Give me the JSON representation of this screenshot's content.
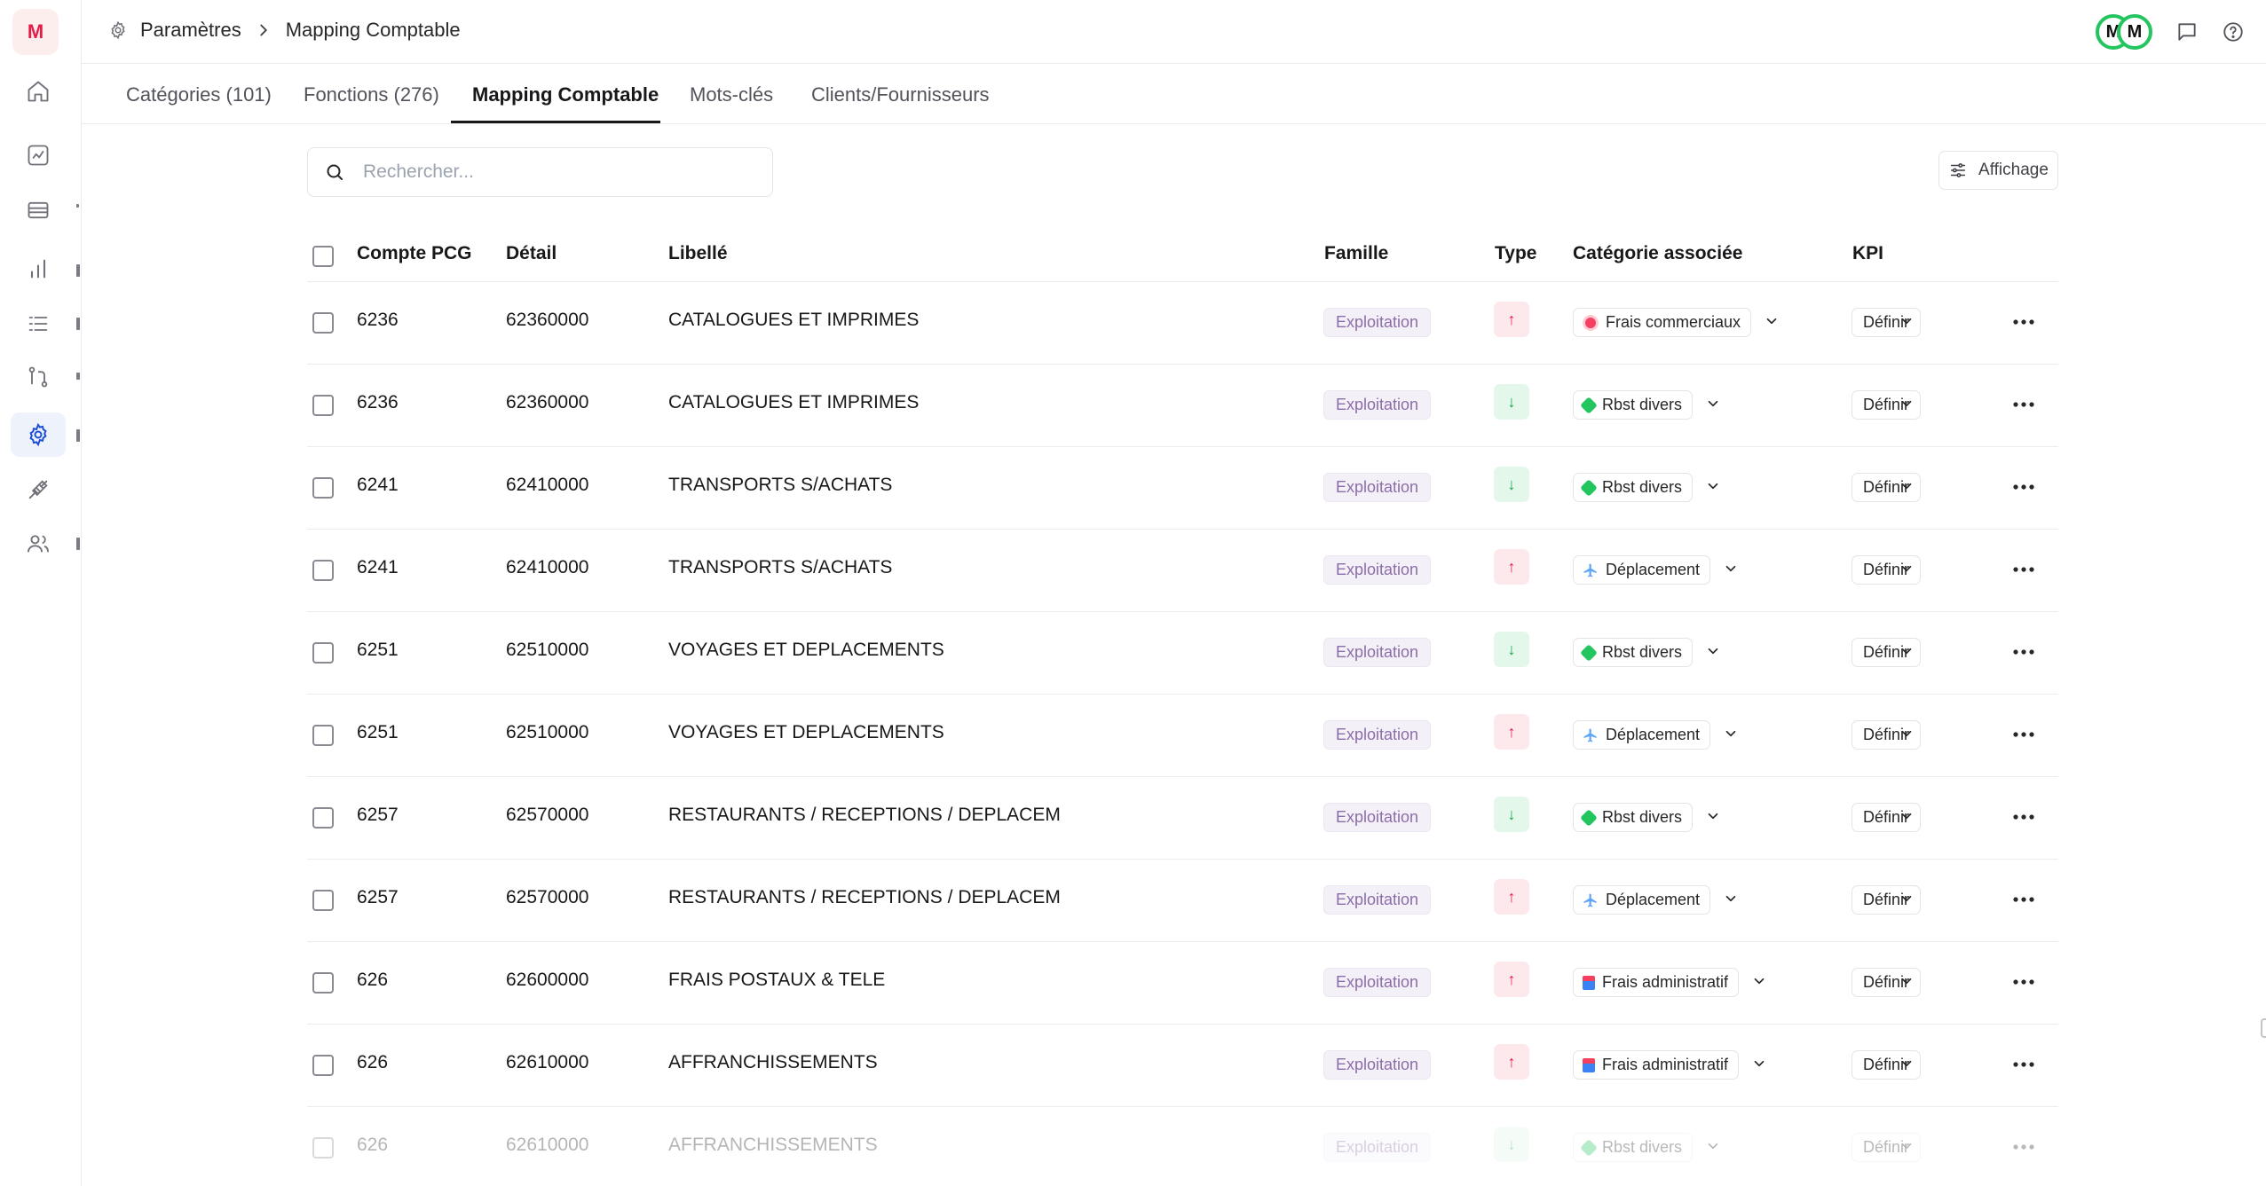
{
  "app": {
    "logo_letter": "M"
  },
  "breadcrumb": {
    "root": "Paramètres",
    "current": "Mapping Comptable"
  },
  "header": {
    "avatars": [
      "M",
      "M"
    ]
  },
  "tabs": [
    {
      "label": "Catégories (101)"
    },
    {
      "label": "Fonctions (276)"
    },
    {
      "label": "Mapping Comptable",
      "active": true
    },
    {
      "label": "Mots-clés"
    },
    {
      "label": "Clients/Fournisseurs"
    }
  ],
  "search": {
    "placeholder": "Rechercher...",
    "value": ""
  },
  "view_button": {
    "label": "Affichage"
  },
  "table": {
    "headers": {
      "compte": "Compte PCG",
      "detail": "Détail",
      "libelle": "Libellé",
      "famille": "Famille",
      "type": "Type",
      "categorie": "Catégorie associée",
      "kpi": "KPI"
    },
    "rows": [
      {
        "compte": "6236",
        "detail": "62360000",
        "libelle": "CATALOGUES ET IMPRIMES",
        "famille": "Exploitation",
        "type": "up",
        "type_glyph": "↑",
        "categorie": "Frais commerciaux",
        "cat_icon": "target-icon",
        "kpi": "Définir"
      },
      {
        "compte": "6236",
        "detail": "62360000",
        "libelle": "CATALOGUES ET IMPRIMES",
        "famille": "Exploitation",
        "type": "down",
        "type_glyph": "↓",
        "categorie": "Rbst divers",
        "cat_icon": "money-icon",
        "kpi": "Définir"
      },
      {
        "compte": "6241",
        "detail": "62410000",
        "libelle": "TRANSPORTS S/ACHATS",
        "famille": "Exploitation",
        "type": "down",
        "type_glyph": "↓",
        "categorie": "Rbst divers",
        "cat_icon": "money-icon",
        "kpi": "Définir"
      },
      {
        "compte": "6241",
        "detail": "62410000",
        "libelle": "TRANSPORTS S/ACHATS",
        "famille": "Exploitation",
        "type": "up",
        "type_glyph": "↑",
        "categorie": "Déplacement",
        "cat_icon": "plane-icon",
        "kpi": "Définir"
      },
      {
        "compte": "6251",
        "detail": "62510000",
        "libelle": "VOYAGES ET DEPLACEMENTS",
        "famille": "Exploitation",
        "type": "down",
        "type_glyph": "↓",
        "categorie": "Rbst divers",
        "cat_icon": "money-icon",
        "kpi": "Définir"
      },
      {
        "compte": "6251",
        "detail": "62510000",
        "libelle": "VOYAGES ET DEPLACEMENTS",
        "famille": "Exploitation",
        "type": "up",
        "type_glyph": "↑",
        "categorie": "Déplacement",
        "cat_icon": "plane-icon",
        "kpi": "Définir"
      },
      {
        "compte": "6257",
        "detail": "62570000",
        "libelle": "RESTAURANTS / RECEPTIONS / DEPLACEM",
        "famille": "Exploitation",
        "type": "down",
        "type_glyph": "↓",
        "categorie": "Rbst divers",
        "cat_icon": "money-icon",
        "kpi": "Définir"
      },
      {
        "compte": "6257",
        "detail": "62570000",
        "libelle": "RESTAURANTS / RECEPTIONS / DEPLACEM",
        "famille": "Exploitation",
        "type": "up",
        "type_glyph": "↑",
        "categorie": "Déplacement",
        "cat_icon": "plane-icon",
        "kpi": "Définir"
      },
      {
        "compte": "626",
        "detail": "62600000",
        "libelle": "FRAIS POSTAUX & TELE",
        "famille": "Exploitation",
        "type": "up",
        "type_glyph": "↑",
        "categorie": "Frais administratif",
        "cat_icon": "building-icon",
        "kpi": "Définir"
      },
      {
        "compte": "626",
        "detail": "62610000",
        "libelle": "AFFRANCHISSEMENTS",
        "famille": "Exploitation",
        "type": "up",
        "type_glyph": "↑",
        "categorie": "Frais administratif",
        "cat_icon": "building-icon",
        "kpi": "Définir"
      },
      {
        "compte": "626",
        "detail": "62610000",
        "libelle": "AFFRANCHISSEMENTS",
        "famille": "Exploitation",
        "type": "down",
        "type_glyph": "↓",
        "categorie": "Rbst divers",
        "cat_icon": "money-icon",
        "kpi": "Définir",
        "faded": true
      }
    ]
  },
  "colors": {
    "accent": "#e11d48",
    "up_bg": "#fde8ec",
    "down_bg": "#e3f7ea",
    "famille_text": "#8b6da8",
    "avatar_ring": "#22c55e"
  }
}
